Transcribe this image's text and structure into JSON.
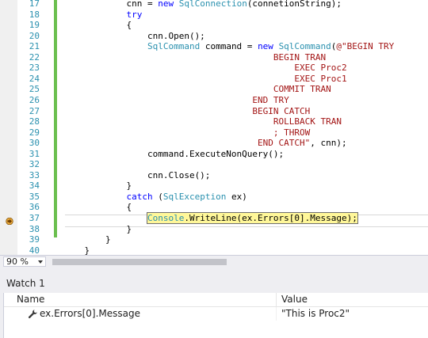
{
  "editor": {
    "lines": [
      {
        "num": "17",
        "code": "            cnn = new SqlConnection(connetionString);"
      },
      {
        "num": "18",
        "code": "            try"
      },
      {
        "num": "19",
        "code": "            {"
      },
      {
        "num": "20",
        "code": "                cnn.Open();"
      },
      {
        "num": "21",
        "code": "                SqlCommand command = new SqlCommand(@\"BEGIN TRY"
      },
      {
        "num": "22",
        "code": "                                        BEGIN TRAN"
      },
      {
        "num": "23",
        "code": "                                            EXEC Proc2"
      },
      {
        "num": "24",
        "code": "                                            EXEC Proc1"
      },
      {
        "num": "25",
        "code": "                                        COMMIT TRAN"
      },
      {
        "num": "26",
        "code": "                                    END TRY"
      },
      {
        "num": "27",
        "code": "                                    BEGIN CATCH"
      },
      {
        "num": "28",
        "code": "                                        ROLLBACK TRAN"
      },
      {
        "num": "29",
        "code": "                                        ; THROW"
      },
      {
        "num": "30",
        "code": "                                     END CATCH\", cnn);"
      },
      {
        "num": "31",
        "code": "                command.ExecuteNonQuery();"
      },
      {
        "num": "32",
        "code": ""
      },
      {
        "num": "33",
        "code": "                cnn.Close();"
      },
      {
        "num": "34",
        "code": "            }"
      },
      {
        "num": "35",
        "code": "            catch (SqlException ex)"
      },
      {
        "num": "36",
        "code": "            {"
      },
      {
        "num": "37",
        "code": "                Console.WriteLine(ex.Errors[0].Message);"
      },
      {
        "num": "38",
        "code": "            }"
      },
      {
        "num": "39",
        "code": "        }"
      },
      {
        "num": "40",
        "code": "    }"
      }
    ],
    "current_line": "37",
    "breakpoint_line": "37"
  },
  "statusbar": {
    "zoom": "90 %"
  },
  "watch": {
    "title": "Watch 1",
    "columns": [
      "Name",
      "Value"
    ],
    "rows": [
      {
        "name": "ex.Errors[0].Message",
        "value": "\"This is Proc2\"",
        "icon": "wrench-icon"
      }
    ]
  },
  "colors": {
    "keyword": "#0000ff",
    "type": "#2b91af",
    "string": "#a31515",
    "highlight": "#fff799",
    "changebar": "#6bbf4f"
  }
}
